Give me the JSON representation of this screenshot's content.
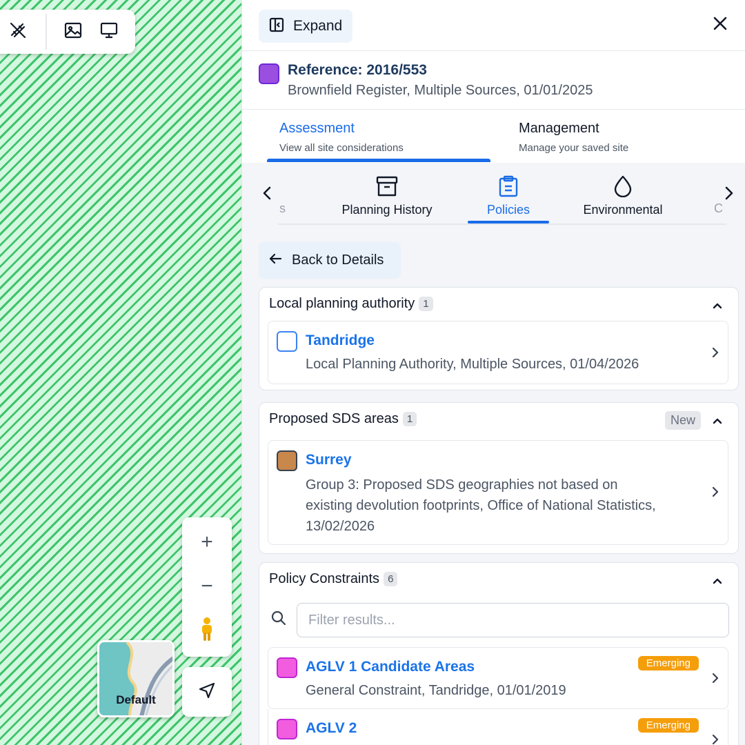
{
  "colors": {
    "accent": "#1a6ce8",
    "link": "#1a73e8",
    "reference_swatch": "#9b4fe0",
    "tandridge_swatch_border": "#3b82f6",
    "surrey_swatch": "#c8874b",
    "aglv_swatch": "#f25de0",
    "emerging_badge": "#f59e0b",
    "map_hatch": "#3fc46b"
  },
  "map": {
    "toolbar": {
      "icons": [
        "draw-tool-icon",
        "image-icon",
        "monitor-icon"
      ]
    },
    "controls": {
      "zoom_in": "+",
      "zoom_out": "−",
      "street_view_icon": "pegman-icon",
      "locate_icon": "navigation-arrow-icon"
    },
    "basemap": {
      "label": "Default"
    }
  },
  "panel": {
    "expand_label": "Expand",
    "reference": {
      "title": "Reference: 2016/553",
      "subtitle": "Brownfield Register, Multiple Sources, 01/01/2025"
    },
    "main_tabs": [
      {
        "label": "Assessment",
        "sublabel": "View all site considerations",
        "active": true
      },
      {
        "label": "Management",
        "sublabel": "Manage your saved site",
        "active": false
      }
    ],
    "sub_tabs": [
      {
        "label": "Planning History",
        "icon": "archive-icon"
      },
      {
        "label": "Policies",
        "icon": "clipboard-icon",
        "active": true
      },
      {
        "label": "Environmental",
        "icon": "droplet-icon"
      }
    ],
    "sub_tabs_cut_left": "s",
    "sub_tabs_cut_right": "C",
    "back_label": "Back to Details",
    "sections": {
      "lpa": {
        "title": "Local planning authority",
        "count": "1",
        "items": [
          {
            "title": "Tandridge",
            "subtitle": "Local Planning Authority, Multiple Sources, 01/04/2026"
          }
        ]
      },
      "sds": {
        "title": "Proposed SDS areas",
        "count": "1",
        "badge": "New",
        "items": [
          {
            "title": "Surrey",
            "subtitle_lines": [
              "Group 3: Proposed SDS geographies not based on",
              "existing devolution footprints, Office of National Statistics,",
              "13/02/2026"
            ]
          }
        ]
      },
      "policy": {
        "title": "Policy Constraints",
        "count": "6",
        "filter_placeholder": "Filter results...",
        "items": [
          {
            "title": "AGLV 1 Candidate Areas",
            "subtitle": "General Constraint, Tandridge, 01/01/2019",
            "badge": "Emerging"
          },
          {
            "title": "AGLV 2",
            "subtitle": "",
            "badge": "Emerging"
          }
        ]
      }
    }
  }
}
